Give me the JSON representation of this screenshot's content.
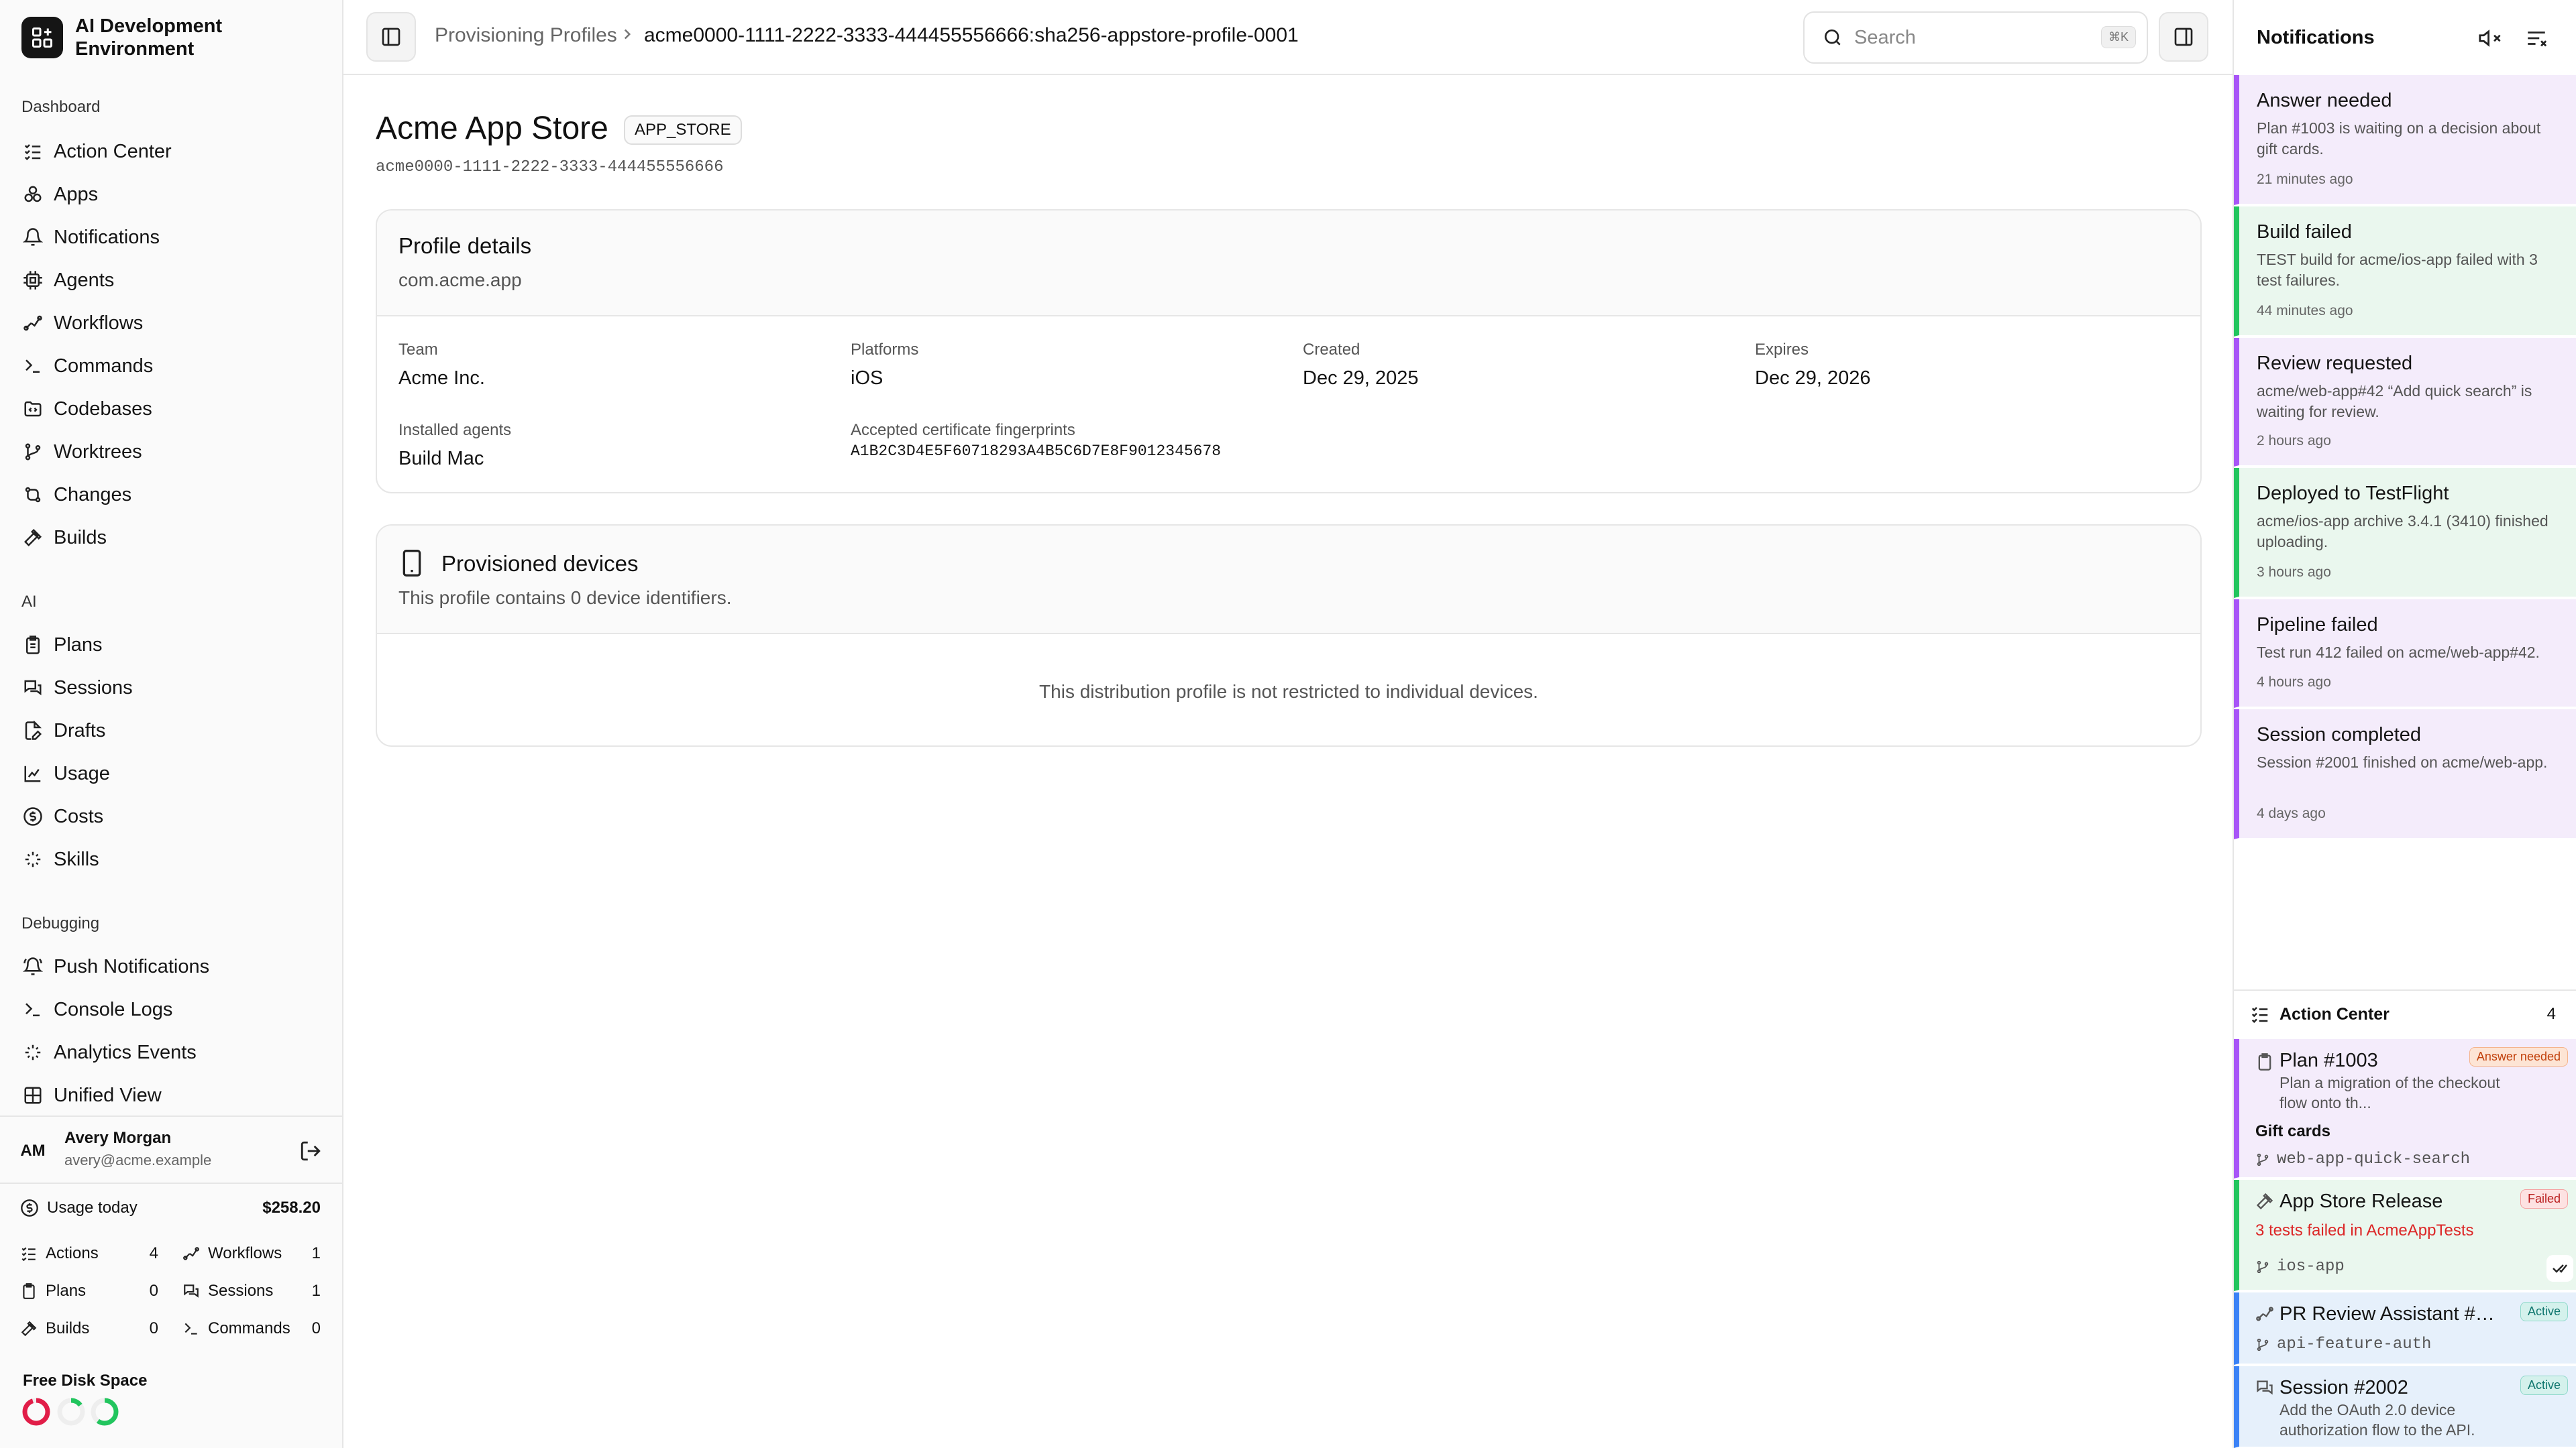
{
  "app": {
    "name": "AI Development Environment"
  },
  "sidebar": {
    "sections": [
      {
        "label": "Dashboard",
        "items": [
          {
            "label": "Action Center",
            "icon": "list-checks-icon"
          },
          {
            "label": "Apps",
            "icon": "apps-icon"
          },
          {
            "label": "Notifications",
            "icon": "bell-icon"
          },
          {
            "label": "Agents",
            "icon": "cpu-icon"
          },
          {
            "label": "Workflows",
            "icon": "workflow-icon"
          },
          {
            "label": "Commands",
            "icon": "terminal-icon"
          },
          {
            "label": "Codebases",
            "icon": "folder-code-icon"
          },
          {
            "label": "Worktrees",
            "icon": "git-branch-icon"
          },
          {
            "label": "Changes",
            "icon": "git-compare-icon"
          },
          {
            "label": "Builds",
            "icon": "hammer-icon"
          }
        ]
      },
      {
        "label": "AI",
        "items": [
          {
            "label": "Plans",
            "icon": "clipboard-icon"
          },
          {
            "label": "Sessions",
            "icon": "chat-icon"
          },
          {
            "label": "Drafts",
            "icon": "file-edit-icon"
          },
          {
            "label": "Usage",
            "icon": "chart-icon"
          },
          {
            "label": "Costs",
            "icon": "dollar-icon"
          },
          {
            "label": "Skills",
            "icon": "sparkle-icon"
          }
        ]
      },
      {
        "label": "Debugging",
        "items": [
          {
            "label": "Push Notifications",
            "icon": "bell-ring-icon"
          },
          {
            "label": "Console Logs",
            "icon": "terminal-icon"
          },
          {
            "label": "Analytics Events",
            "icon": "sparkle-icon"
          },
          {
            "label": "Unified View",
            "icon": "layout-icon"
          }
        ]
      }
    ],
    "user": {
      "initials": "AM",
      "name": "Avery Morgan",
      "email": "avery@acme.example"
    },
    "usage": {
      "label": "Usage today",
      "value": "$258.20"
    },
    "stats": [
      {
        "label": "Actions",
        "value": "4"
      },
      {
        "label": "Workflows",
        "value": "1"
      },
      {
        "label": "Plans",
        "value": "0"
      },
      {
        "label": "Sessions",
        "value": "1"
      },
      {
        "label": "Builds",
        "value": "0"
      },
      {
        "label": "Commands",
        "value": "0"
      }
    ],
    "disk": {
      "label": "Free Disk Space",
      "levels": [
        0.05,
        0.85,
        0.4
      ],
      "colors": [
        "#e11d48",
        "#22c55e",
        "#22c55e"
      ]
    }
  },
  "topbar": {
    "breadcrumb": [
      "Provisioning Profiles",
      "acme0000-1111-2222-3333-444455556666:sha256-appstore-profile-0001"
    ],
    "search": {
      "placeholder": "Search",
      "shortcut": "⌘K"
    }
  },
  "profile": {
    "title": "Acme App Store",
    "type_badge": "APP_STORE",
    "id": "acme0000-1111-2222-3333-444455556666",
    "details": {
      "title": "Profile details",
      "bundle_id": "com.acme.app",
      "team": {
        "label": "Team",
        "value": "Acme Inc."
      },
      "platforms": {
        "label": "Platforms",
        "value": "iOS"
      },
      "created": {
        "label": "Created",
        "value": "Dec 29, 2025"
      },
      "expires": {
        "label": "Expires",
        "value": "Dec 29, 2026"
      },
      "agents": {
        "label": "Installed agents",
        "value": "Build Mac"
      },
      "fingerprints": {
        "label": "Accepted certificate fingerprints",
        "value": "A1B2C3D4E5F60718293A4B5C6D7E8F9012345678"
      }
    },
    "devices": {
      "title": "Provisioned devices",
      "subtitle": "This profile contains 0 device identifiers.",
      "empty": "This distribution profile is not restricted to individual devices."
    }
  },
  "notifications": {
    "title": "Notifications",
    "items": [
      {
        "title": "Answer needed",
        "body": "Plan #1003 is waiting on a decision about gift cards.",
        "time": "21 minutes ago",
        "accent": "#a855f7",
        "bg": "#f4ecfb"
      },
      {
        "title": "Build failed",
        "body": "TEST build for acme/ios-app failed with 3 test failures.",
        "time": "44 minutes ago",
        "accent": "#22c55e",
        "bg": "#eaf7ee"
      },
      {
        "title": "Review requested",
        "body": "acme/web-app#42 “Add quick search” is waiting for review.",
        "time": "2 hours ago",
        "accent": "#a855f7",
        "bg": "#f4ecfb"
      },
      {
        "title": "Deployed to TestFlight",
        "body": "acme/ios-app archive 3.4.1 (3410) finished uploading.",
        "time": "3 hours ago",
        "accent": "#22c55e",
        "bg": "#eaf7ee"
      },
      {
        "title": "Pipeline failed",
        "body": "Test run 412 failed on acme/web-app#42.",
        "time": "4 hours ago",
        "accent": "#a855f7",
        "bg": "#f4ecfb"
      },
      {
        "title": "Session completed",
        "body": "Session #2001 finished on acme/web-app.",
        "time": "4 days ago",
        "accent": "#a855f7",
        "bg": "#f4ecfb"
      }
    ]
  },
  "action_center": {
    "title": "Action Center",
    "count": "4",
    "items": [
      {
        "title": "Plan #1003",
        "status": "Answer needed",
        "desc": "Plan a migration of the checkout flow onto th...",
        "question": "Gift cards",
        "branch": "web-app-quick-search"
      },
      {
        "title": "App Store Release",
        "status": "Failed",
        "desc": "3 tests failed in AcmeAppTests",
        "branch": "ios-app"
      },
      {
        "title": "PR Review Assistant #4...",
        "status": "Active",
        "branch": "api-feature-auth"
      },
      {
        "title": "Session #2002",
        "status": "Active",
        "desc": "Add the OAuth 2.0 device authorization flow to the API."
      }
    ]
  }
}
